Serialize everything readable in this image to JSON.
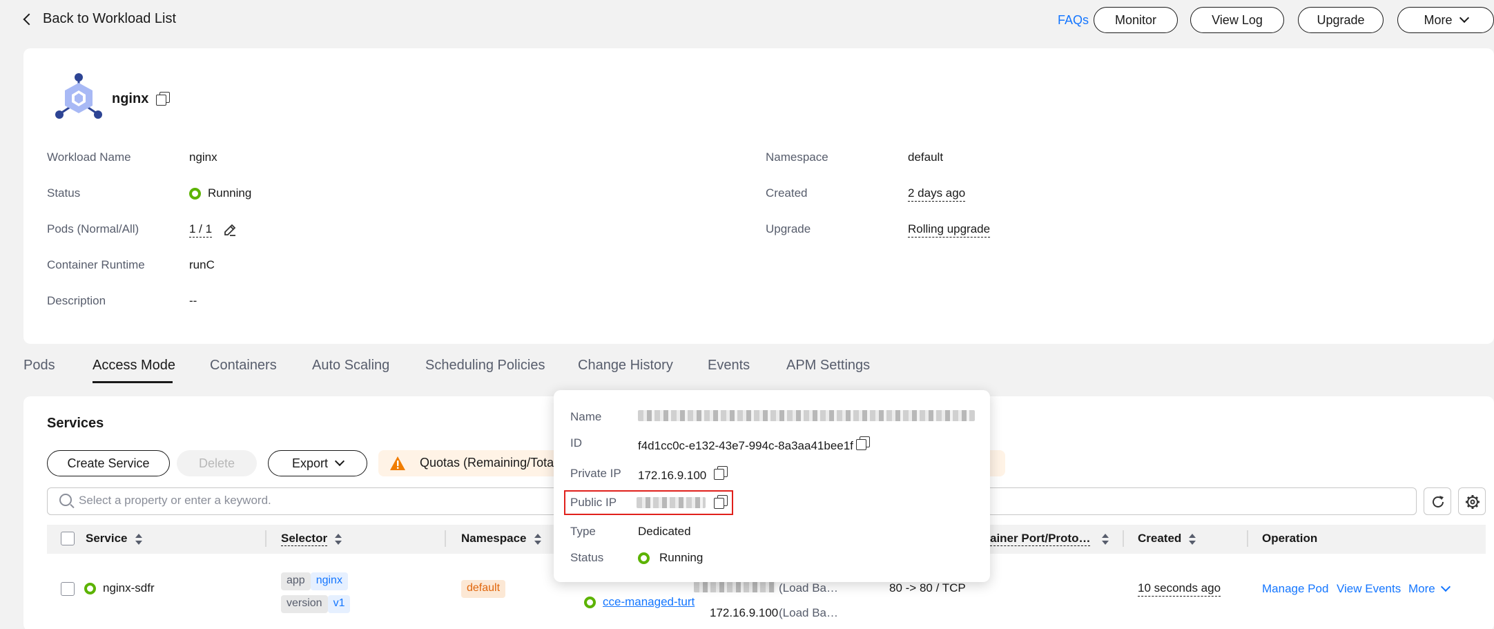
{
  "header": {
    "back_label": "Back to Workload List",
    "faqs": "FAQs",
    "buttons": {
      "monitor": "Monitor",
      "view_log": "View Log",
      "upgrade": "Upgrade",
      "more": "More"
    }
  },
  "workload": {
    "title": "nginx",
    "fields_left": [
      {
        "label": "Workload Name",
        "value": "nginx"
      },
      {
        "label": "Status",
        "value": "Running"
      },
      {
        "label": "Pods (Normal/All)",
        "value": "1 / 1"
      },
      {
        "label": "Container Runtime",
        "value": "runC"
      },
      {
        "label": "Description",
        "value": "--"
      }
    ],
    "fields_right": [
      {
        "label": "Namespace",
        "value": "default"
      },
      {
        "label": "Created",
        "value": "2 days ago"
      },
      {
        "label": "Upgrade",
        "value": "Rolling upgrade"
      }
    ]
  },
  "tabs": [
    "Pods",
    "Access Mode",
    "Containers",
    "Auto Scaling",
    "Scheduling Policies",
    "Change History",
    "Events",
    "APM Settings"
  ],
  "services": {
    "title": "Services",
    "create_label": "Create Service",
    "delete_label": "Delete",
    "export_label": "Export",
    "quota_text": "Quotas (Remaining/Total):",
    "search_placeholder": "Select a property or enter a keyword.",
    "columns": [
      "Service",
      "Selector",
      "Namespace",
      "ainer Port/Proto…",
      "Created",
      "Operation"
    ],
    "row": {
      "name": "nginx-sdfr",
      "selector_tags": [
        {
          "key": "app",
          "value": "nginx"
        },
        {
          "key": "version",
          "value": "v1"
        }
      ],
      "namespace": "default",
      "lb_link": "cce-managed-turt",
      "lb_type_1": "(Load Ba…",
      "lb_ip": "172.16.9.100",
      "lb_type_2": "(Load Ba…",
      "ports": "80 -> 80 / TCP",
      "created": "10 seconds ago",
      "ops": {
        "manage_pod": "Manage Pod",
        "view_events": "View Events",
        "more": "More"
      }
    }
  },
  "popover": {
    "name_label": "Name",
    "id_label": "ID",
    "id_value": "f4d1cc0c-e132-43e7-994c-8a3aa41bee1f",
    "private_ip_label": "Private IP",
    "private_ip_value": "172.16.9.100",
    "public_ip_label": "Public IP",
    "type_label": "Type",
    "type_value": "Dedicated",
    "status_label": "Status",
    "status_value": "Running"
  },
  "colors": {
    "accent": "#1476ff",
    "running": "#5cb300",
    "highlight": "#e0201b",
    "warning": "#f07d00"
  }
}
